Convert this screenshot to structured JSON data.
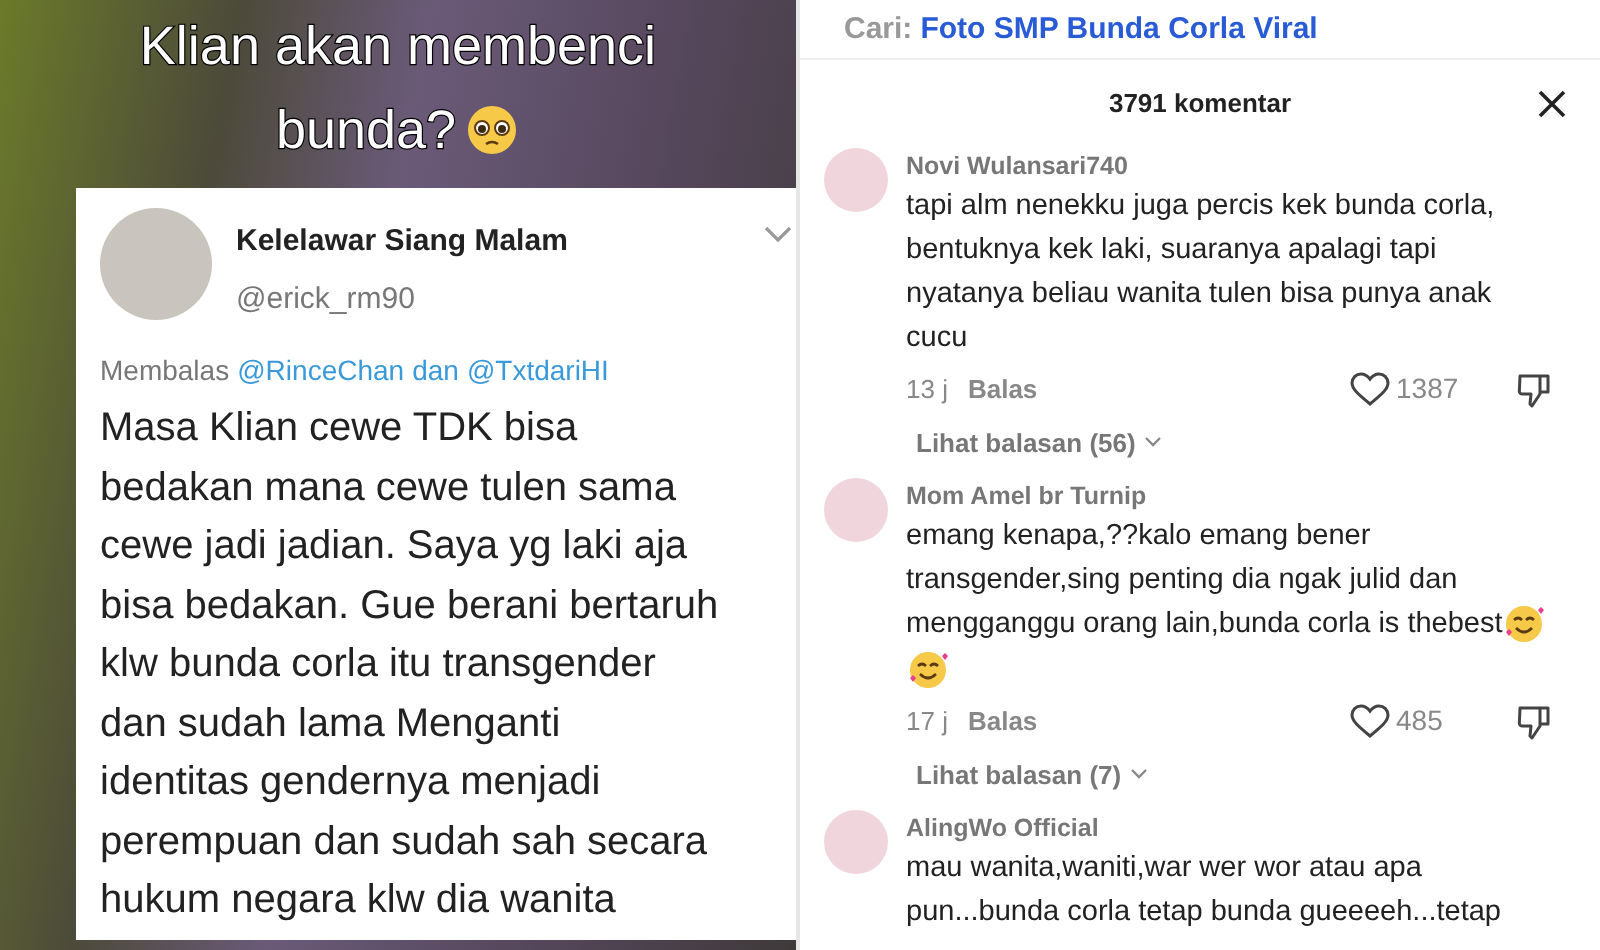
{
  "video": {
    "caption_lines": [
      "Klian akan membenci",
      "bunda?"
    ],
    "tweet": {
      "name": "Kelelawar Siang Malam",
      "handle": "@erick_rm90",
      "reply_prefix": "Membalas",
      "mentions": [
        "@RinceChan",
        "@TxtdariHI"
      ],
      "mention_joiner": "dan",
      "body_lines": [
        "Masa Klian cewe TDK bisa",
        "bedakan mana cewe tulen sama",
        "cewe jadi jadian. Saya yg laki aja",
        "bisa bedakan. Gue berani bertaruh",
        "klw bunda corla itu transgender",
        "dan sudah lama Menganti",
        "identitas gendernya menjadi",
        "perempuan dan sudah sah secara",
        "hukum negara klw dia wanita"
      ]
    }
  },
  "search": {
    "label": "Cari:",
    "query": "Foto SMP Bunda Corla Viral"
  },
  "comments_header": {
    "title": "3791 komentar"
  },
  "comments": [
    {
      "user": "Novi Wulansari740",
      "lines": [
        "tapi alm nenekku juga percis kek bunda corla,",
        "bentuknya kek laki, suaranya apalagi tapi",
        "nyatanya beliau wanita tulen bisa punya anak",
        "cucu"
      ],
      "time": "13 j",
      "reply": "Balas",
      "likes": "1387",
      "replies": "Lihat balasan (56)"
    },
    {
      "user": "Mom Amel br Turnip",
      "lines": [
        "emang kenapa,??kalo emang bener",
        "transgender,sing penting dia ngak julid dan",
        "mengganggu orang lain,bunda corla is thebest"
      ],
      "emojis": [
        {
          "kind": "inline"
        },
        {
          "kind": "newline"
        }
      ],
      "time": "17 j",
      "reply": "Balas",
      "likes": "485",
      "replies": "Lihat balasan (7)"
    },
    {
      "user": "AlingWo Official",
      "lines": [
        "mau wanita,waniti,war wer wor atau apa",
        "pun...bunda corla tetap bunda gueeeeh...tetap"
      ]
    }
  ]
}
